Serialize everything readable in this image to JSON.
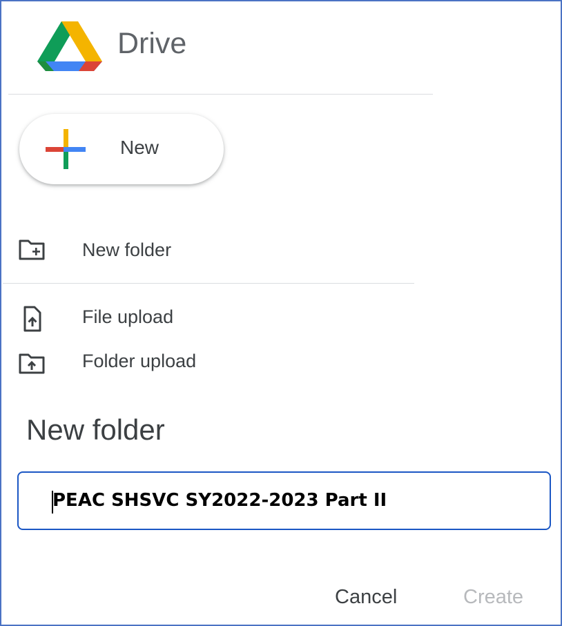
{
  "header": {
    "app_name": "Drive",
    "logo_icon": "google-drive-logo-icon"
  },
  "new_button": {
    "label": "New",
    "icon": "plus-icon"
  },
  "menu": {
    "items": [
      {
        "label": "New folder",
        "icon": "folder-plus-icon"
      },
      {
        "label": "File upload",
        "icon": "file-upload-icon"
      },
      {
        "label": "Folder upload",
        "icon": "folder-upload-icon"
      }
    ]
  },
  "dialog": {
    "title": "New folder",
    "folder_name_value": "PEAC SHSVC SY2022-2023 Part II",
    "cancel_label": "Cancel",
    "create_label": "Create"
  },
  "colors": {
    "frame_border": "#4a72c4",
    "input_focus_border": "#1a56c4",
    "text_primary": "#3c4043",
    "text_secondary": "#5f6368",
    "disabled_text": "#b7b9bc",
    "drive_green": "#0f9d58",
    "drive_blue": "#4285f4",
    "drive_yellow": "#f4b400",
    "drive_red": "#db4437"
  }
}
